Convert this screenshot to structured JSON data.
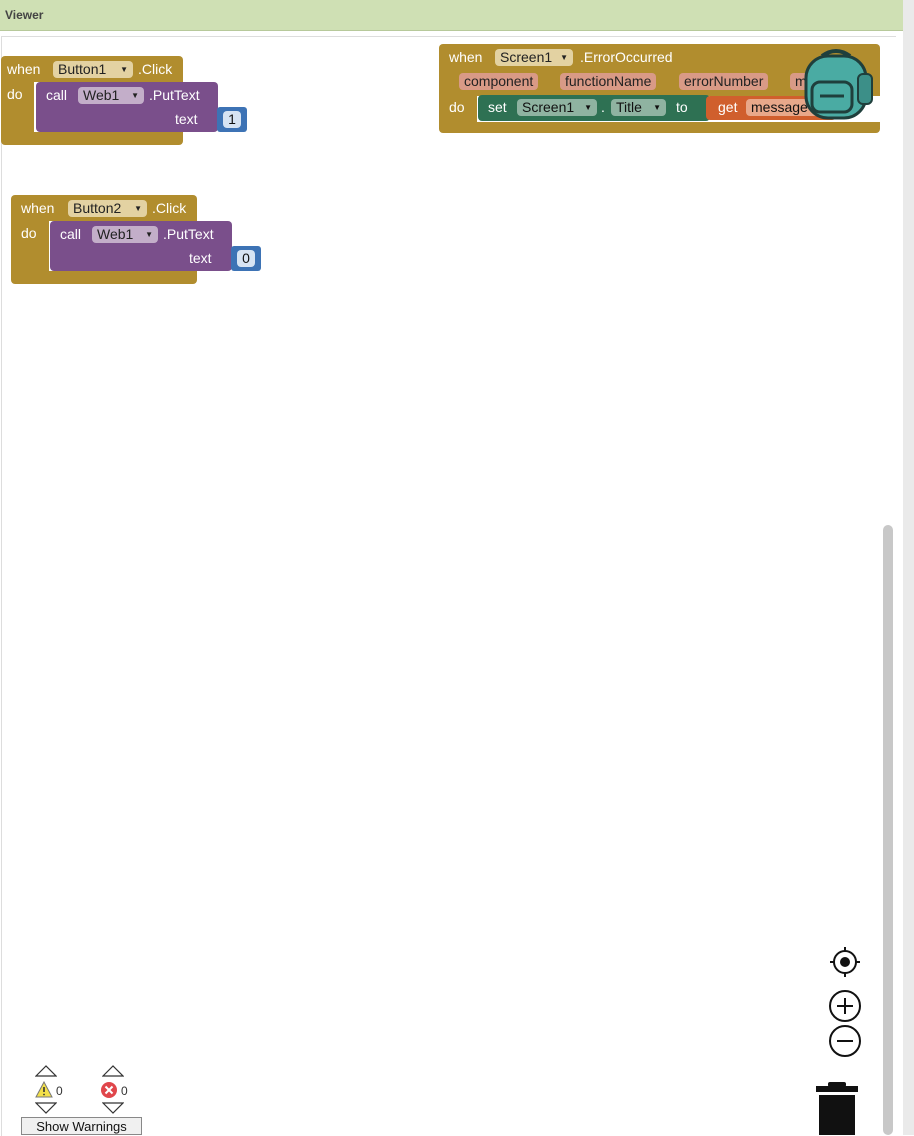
{
  "panel": {
    "title": "Viewer"
  },
  "blocks": {
    "button1_click": {
      "when": "when",
      "component": "Button1",
      "event": ".Click",
      "do": "do",
      "call": "call",
      "target": "Web1",
      "method": ".PutText",
      "arg_label": "text",
      "value": "1"
    },
    "button2_click": {
      "when": "when",
      "component": "Button2",
      "event": ".Click",
      "do": "do",
      "call": "call",
      "target": "Web1",
      "method": ".PutText",
      "arg_label": "text",
      "value": "0"
    },
    "screen1_error": {
      "when": "when",
      "component": "Screen1",
      "event": ".ErrorOccurred",
      "params": [
        "component",
        "functionName",
        "errorNumber",
        "m"
      ],
      "do": "do",
      "set": "set",
      "set_component": "Screen1",
      "dot": ".",
      "property": "Title",
      "to": "to",
      "get": "get",
      "get_var": "message"
    }
  },
  "warnings": {
    "count": "0",
    "errors": "0",
    "show_label": "Show Warnings"
  },
  "colors": {
    "event_block": "#b18d2e",
    "method_block": "#7a4f8b",
    "number_block": "#3d73b5",
    "set_block": "#2e7153",
    "get_block": "#d05f2d",
    "param_pill": "#d99a86",
    "backpack": "#4aaba3"
  },
  "icons": [
    "backpack-icon",
    "recenter-icon",
    "zoom-in-icon",
    "zoom-out-icon",
    "trash-icon",
    "warning-icon",
    "error-icon"
  ]
}
